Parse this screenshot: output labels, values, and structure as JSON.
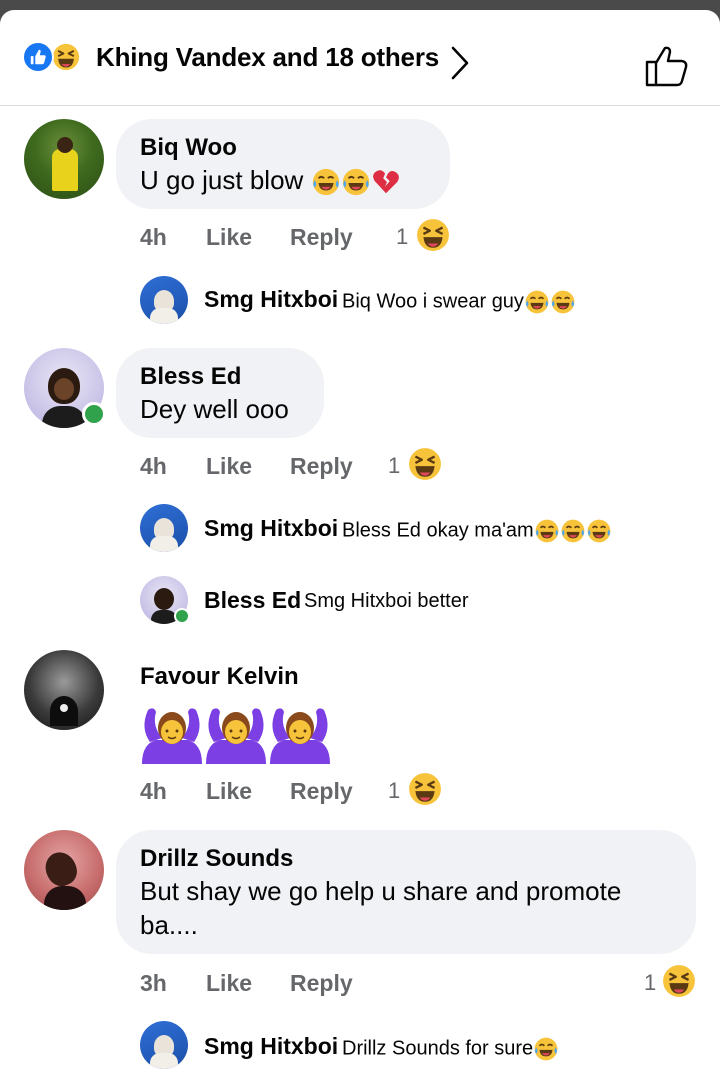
{
  "header": {
    "reaction_summary": "Khing Vandex and 18 others",
    "reaction_icons": [
      "like-icon",
      "haha-icon"
    ],
    "colors": {
      "like": "#1877f2",
      "haha": "#f7c33b",
      "online": "#31a24c"
    }
  },
  "comments": [
    {
      "author": "Biq Woo",
      "text": "U go just blow",
      "emojis": [
        "tears-of-joy",
        "tears-of-joy",
        "broken-heart"
      ],
      "time": "4h",
      "like": "Like",
      "reply": "Reply",
      "reactions": "1",
      "replies": [
        {
          "author": "Smg Hitxboi",
          "text": "Biq Woo i swear guy",
          "emojis": [
            "tears-of-joy",
            "tears-of-joy"
          ]
        }
      ]
    },
    {
      "author": "Bless Ed",
      "text": "Dey well ooo",
      "emojis": [],
      "time": "4h",
      "like": "Like",
      "reply": "Reply",
      "reactions": "1",
      "replies": [
        {
          "author": "Smg Hitxboi",
          "text": "Bless Ed okay ma'am",
          "emojis": [
            "tears-of-joy",
            "tears-of-joy",
            "tears-of-joy"
          ]
        },
        {
          "author": "Bless Ed",
          "text": "Smg Hitxboi better",
          "emojis": []
        }
      ]
    },
    {
      "author": "Favour Kelvin",
      "text": "",
      "emojis": [
        "person-gesturing-ok",
        "person-gesturing-ok",
        "person-gesturing-ok"
      ],
      "time": "4h",
      "like": "Like",
      "reply": "Reply",
      "reactions": "1",
      "replies": []
    },
    {
      "author": "Drillz Sounds",
      "text_line1": "But shay we go help u share and promote",
      "text_line2": "ba....",
      "time": "3h",
      "like": "Like",
      "reply": "Reply",
      "reactions": "1",
      "replies": [
        {
          "author": "Smg Hitxboi",
          "text": "Drillz Sounds for sure",
          "emojis": [
            "tears-of-joy"
          ]
        }
      ]
    }
  ]
}
